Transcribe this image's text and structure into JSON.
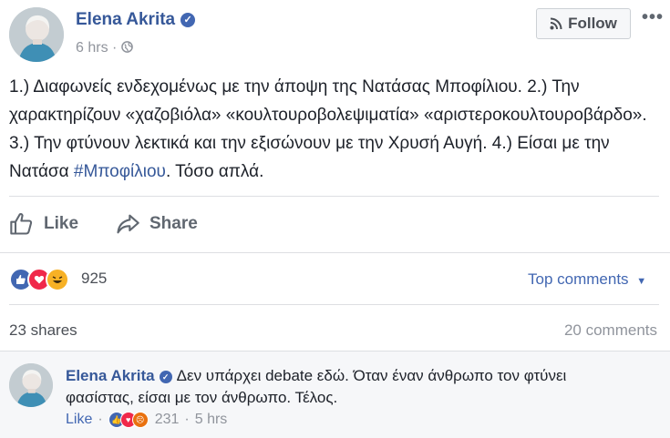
{
  "post": {
    "author": "Elena Akrita",
    "time": "6 hrs",
    "follow_label": "Follow",
    "more_label": "•••",
    "text_before_tag": "1.) Διαφωνείς ενδεχομένως με την άποψη της Νατάσας Μποφίλιου. 2.) Την χαρακτηρίζουν «χαζοβιόλα» «κουλτουροβολεψιματία» «αριστεροκουλτουροβάρδο». 3.) Την φτύνουν λεκτικά και την εξισώνουν με την Χρυσή Αυγή. 4.) Είσαι με την Νατάσα ",
    "hashtag": "#Μποφίλιου",
    "text_after_tag": ". Τόσο απλά."
  },
  "actions": {
    "like_label": "Like",
    "share_label": "Share"
  },
  "stats": {
    "reaction_count": "925",
    "reactions": [
      "like-icon",
      "love-icon",
      "haha-icon"
    ],
    "top_comments_label": "Top comments",
    "shares": "23 shares",
    "comments": "20 comments"
  },
  "comment": {
    "author": "Elena Akrita",
    "text": "Δεν υπάρχει debate εδώ. Όταν έναν άνθρωπο τον φτύνει φασίστας, είσαι με τον άνθρωπο. Τέλος.",
    "like_label": "Like",
    "reaction_count": "231",
    "separator": "·",
    "time": "5 hrs"
  },
  "colors": {
    "link": "#365899",
    "accent": "#4267b2",
    "like": "#4267b2",
    "love": "#f0284a",
    "haha": "#f7b125"
  }
}
